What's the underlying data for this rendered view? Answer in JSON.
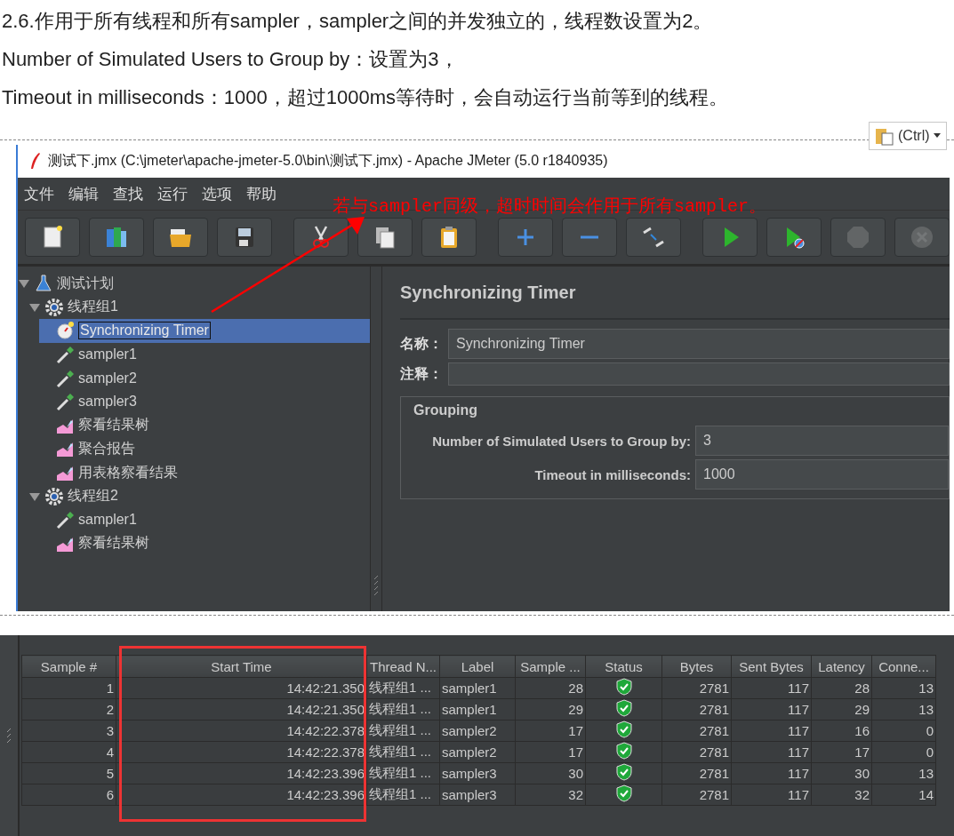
{
  "article": {
    "paragraphs": [
      "2.6.作用于所有线程和所有sampler，sampler之间的并发独立的，线程数设置为2。",
      "Number of Simulated Users to Group by：设置为3，",
      "Timeout in milliseconds：1000，超过1000ms等待时，会自动运行当前等到的线程。"
    ]
  },
  "paste_options": {
    "label": "(Ctrl)"
  },
  "jmeter_window": {
    "title": "测试下.jmx (C:\\jmeter\\apache-jmeter-5.0\\bin\\测试下.jmx) - Apache JMeter (5.0 r1840935)",
    "menu": [
      "文件",
      "编辑",
      "查找",
      "运行",
      "选项",
      "帮助"
    ],
    "toolbar": [
      {
        "kind": "new",
        "disabled": false
      },
      {
        "kind": "templates",
        "disabled": false
      },
      {
        "kind": "open",
        "disabled": false
      },
      {
        "kind": "save",
        "disabled": false
      },
      {
        "kind": "cut",
        "disabled": false
      },
      {
        "kind": "copy",
        "disabled": false
      },
      {
        "kind": "paste",
        "disabled": false
      },
      {
        "kind": "expand",
        "disabled": false
      },
      {
        "kind": "collapse",
        "disabled": false
      },
      {
        "kind": "toggle",
        "disabled": false
      },
      {
        "kind": "start",
        "disabled": false
      },
      {
        "kind": "start-no-timers",
        "disabled": false
      },
      {
        "kind": "stop",
        "disabled": true
      },
      {
        "kind": "shutdown",
        "disabled": true
      }
    ],
    "annotation": "若与sampler同级，超时时间会作用于所有sampler。",
    "tree": [
      {
        "label": "测试计划",
        "kind": "plan",
        "expanded": true,
        "selected": false,
        "children": [
          {
            "label": "线程组1",
            "kind": "thread-group",
            "expanded": true,
            "selected": false,
            "children": [
              {
                "label": "Synchronizing Timer",
                "kind": "timer",
                "selected": true
              },
              {
                "label": "sampler1",
                "kind": "sampler",
                "selected": false
              },
              {
                "label": "sampler2",
                "kind": "sampler",
                "selected": false
              },
              {
                "label": "sampler3",
                "kind": "sampler",
                "selected": false
              },
              {
                "label": "察看结果树",
                "kind": "listener",
                "selected": false
              },
              {
                "label": "聚合报告",
                "kind": "listener",
                "selected": false
              },
              {
                "label": "用表格察看结果",
                "kind": "listener",
                "selected": false
              }
            ]
          },
          {
            "label": "线程组2",
            "kind": "thread-group",
            "expanded": true,
            "selected": false,
            "children": [
              {
                "label": "sampler1",
                "kind": "sampler",
                "selected": false
              },
              {
                "label": "察看结果树",
                "kind": "listener",
                "selected": false
              }
            ]
          }
        ]
      }
    ],
    "editor": {
      "title": "Synchronizing Timer",
      "name_label": "名称：",
      "name_value": "Synchronizing Timer",
      "comment_label": "注释：",
      "group_title": "Grouping",
      "fields": [
        {
          "label": "Number of Simulated Users to Group by:",
          "value": "3"
        },
        {
          "label": "Timeout in milliseconds:",
          "value": "1000"
        }
      ]
    }
  },
  "results_table": {
    "columns": [
      {
        "label": "Sample #",
        "highlighted": false
      },
      {
        "label": "Start Time",
        "highlighted": true
      },
      {
        "label": "Thread N...",
        "highlighted": false
      },
      {
        "label": "Label",
        "highlighted": false
      },
      {
        "label": "Sample ...",
        "highlighted": false
      },
      {
        "label": "Status",
        "highlighted": false
      },
      {
        "label": "Bytes",
        "highlighted": false
      },
      {
        "label": "Sent Bytes",
        "highlighted": false
      },
      {
        "label": "Latency",
        "highlighted": false
      },
      {
        "label": "Conne...",
        "highlighted": false
      }
    ],
    "rows": [
      {
        "cells": [
          "1",
          "14:42:21.350",
          "线程组1 ...",
          "sampler1",
          "28",
          "",
          "2781",
          "117",
          "28",
          "13"
        ],
        "passed": true
      },
      {
        "cells": [
          "2",
          "14:42:21.350",
          "线程组1 ...",
          "sampler1",
          "29",
          "",
          "2781",
          "117",
          "29",
          "13"
        ],
        "passed": true
      },
      {
        "cells": [
          "3",
          "14:42:22.378",
          "线程组1 ...",
          "sampler2",
          "17",
          "",
          "2781",
          "117",
          "16",
          "0"
        ],
        "passed": true
      },
      {
        "cells": [
          "4",
          "14:42:22.378",
          "线程组1 ...",
          "sampler2",
          "17",
          "",
          "2781",
          "117",
          "17",
          "0"
        ],
        "passed": true
      },
      {
        "cells": [
          "5",
          "14:42:23.396",
          "线程组1 ...",
          "sampler3",
          "30",
          "",
          "2781",
          "117",
          "30",
          "13"
        ],
        "passed": true
      },
      {
        "cells": [
          "6",
          "14:42:23.396",
          "线程组1 ...",
          "sampler3",
          "32",
          "",
          "2781",
          "117",
          "32",
          "14"
        ],
        "passed": true
      }
    ]
  }
}
